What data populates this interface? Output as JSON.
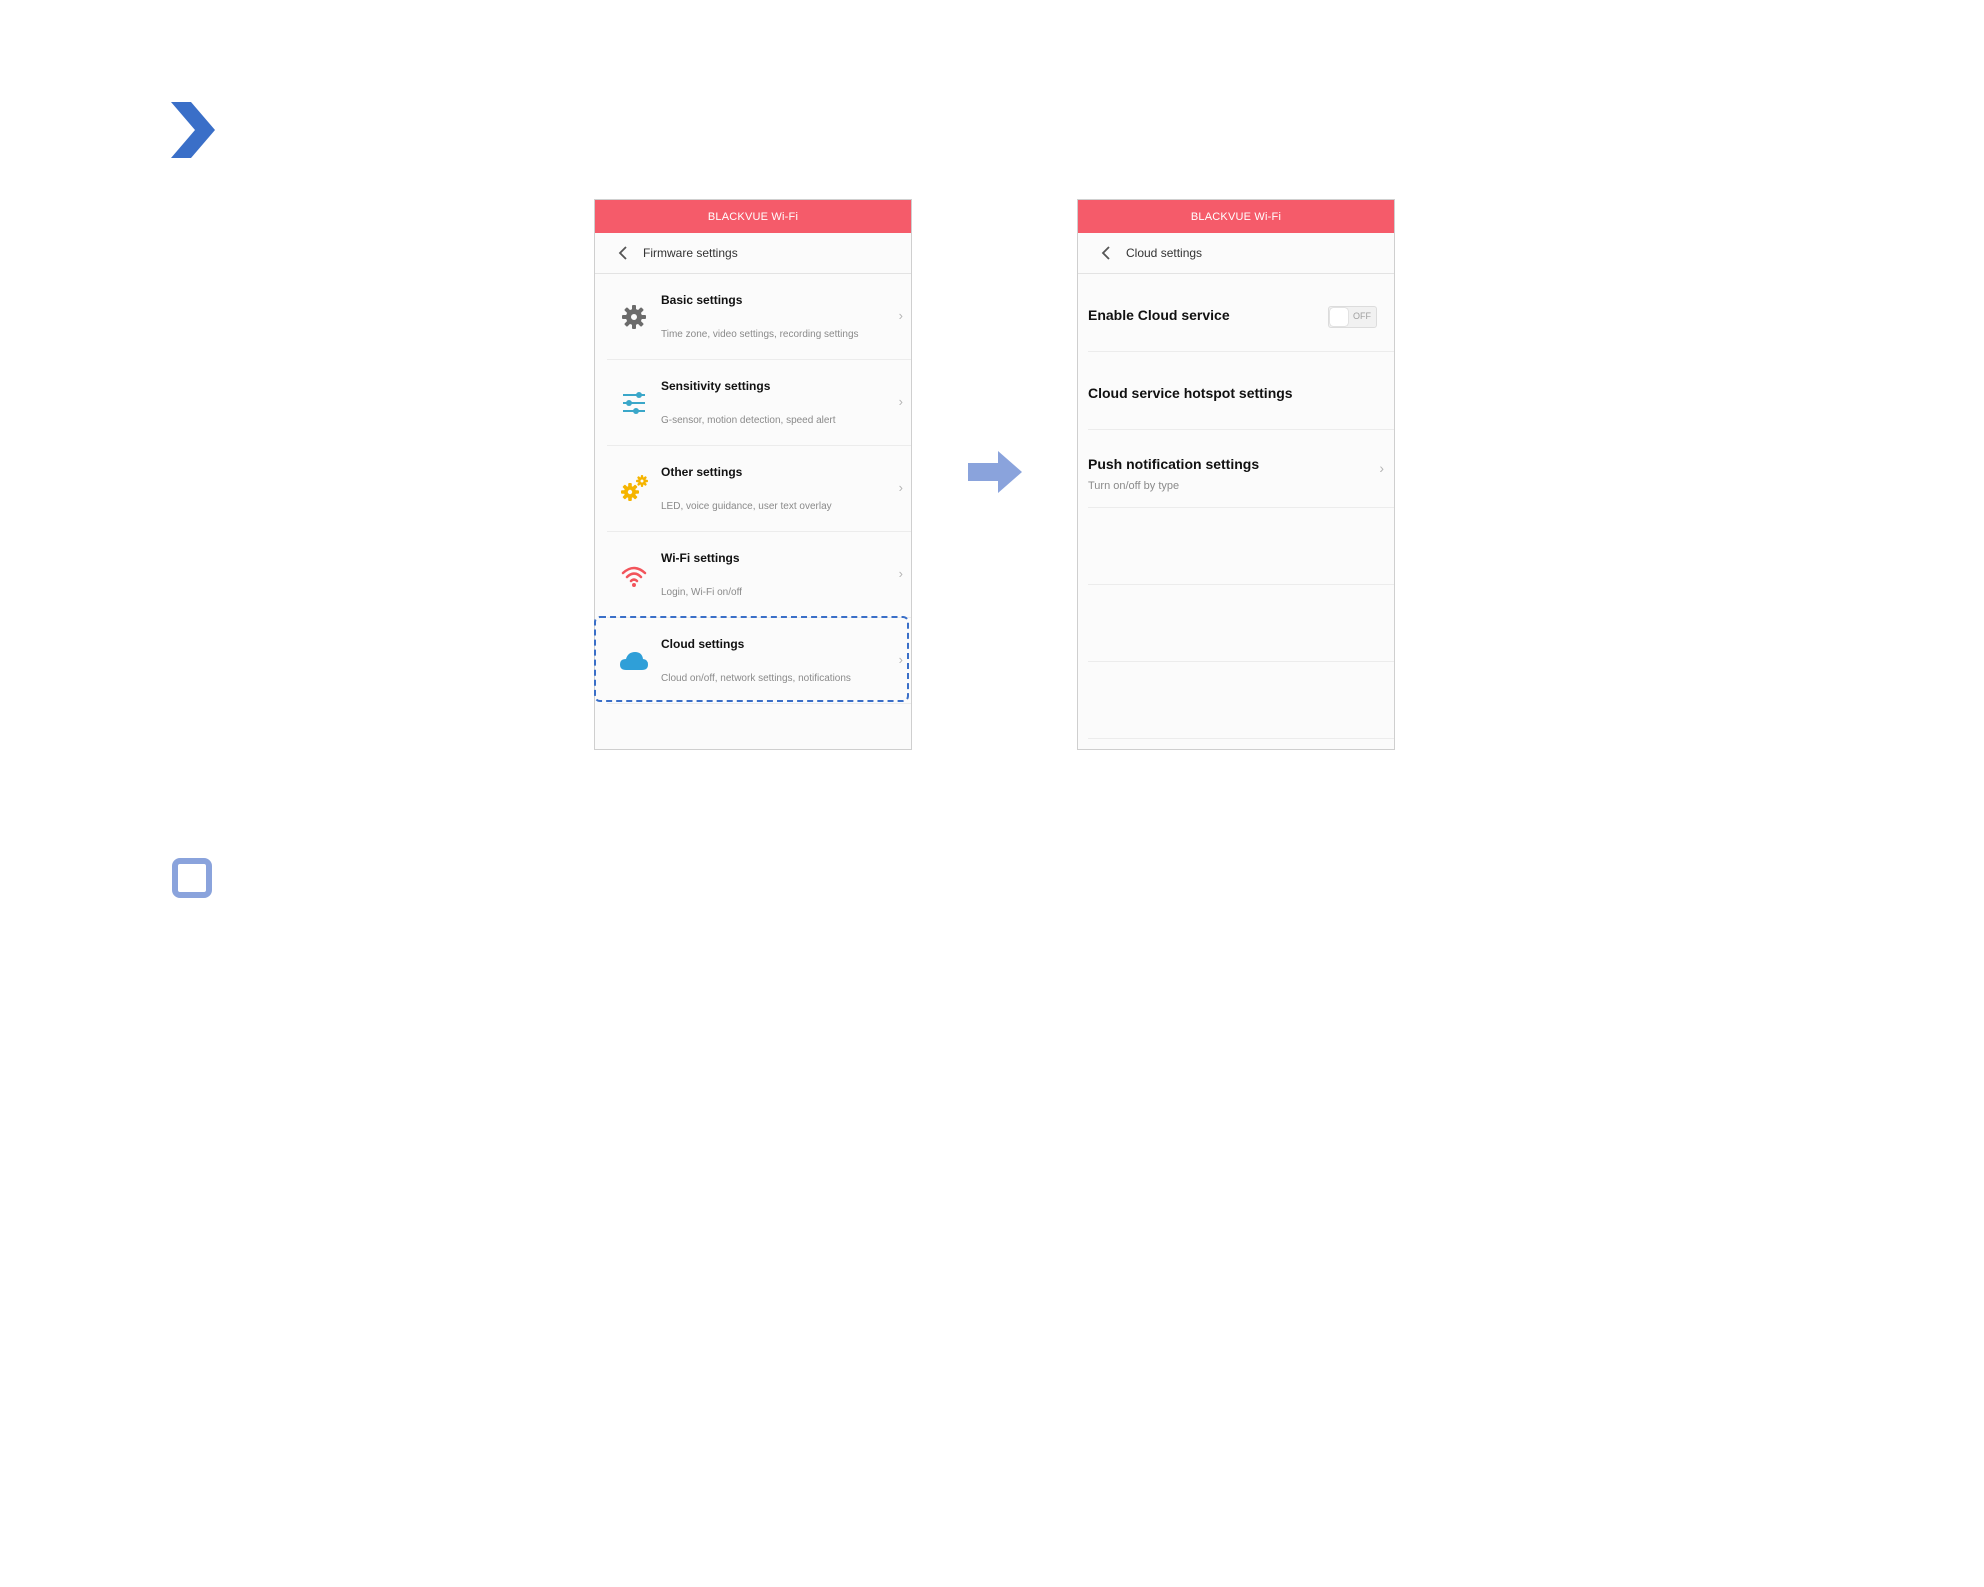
{
  "app": {
    "brand": "BLACKVUE Wi-Fi",
    "accent_color": "#f55b6a",
    "highlight_color": "#3a6fc8"
  },
  "left_screen": {
    "back_icon": "chevron-left-icon",
    "title": "Firmware settings",
    "items": [
      {
        "icon": "gear-icon",
        "title": "Basic settings",
        "subtitle": "Time zone, video settings, recording settings"
      },
      {
        "icon": "sliders-icon",
        "title": "Sensitivity settings",
        "subtitle": "G-sensor, motion detection, speed alert"
      },
      {
        "icon": "gears-icon",
        "title": "Other settings",
        "subtitle": "LED, voice guidance, user text overlay"
      },
      {
        "icon": "wifi-icon",
        "title": "Wi-Fi settings",
        "subtitle": "Login, Wi-Fi on/off"
      },
      {
        "icon": "cloud-icon",
        "title": "Cloud settings",
        "subtitle": "Cloud on/off, network settings, notifications"
      }
    ]
  },
  "right_screen": {
    "back_icon": "chevron-left-icon",
    "title": "Cloud settings",
    "enable_cloud": {
      "label": "Enable Cloud service",
      "toggle_text": "OFF"
    },
    "hotspot": {
      "label": "Cloud service hotspot settings"
    },
    "push": {
      "label": "Push notification settings",
      "subtitle": "Turn on/off by type"
    }
  }
}
